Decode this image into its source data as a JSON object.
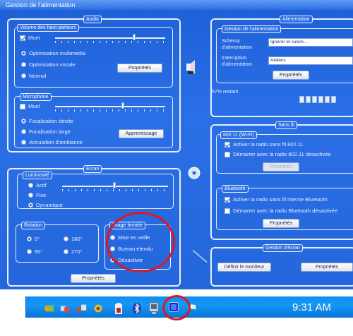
{
  "window": {
    "title": "Gestion de l'alimentation",
    "left_icons": [
      "speaker-icon",
      "microphone-icon"
    ],
    "center_icon": "cd-icon"
  },
  "audio": {
    "title": "Audio",
    "volume": {
      "legend": "Volume des haut-parleurs",
      "mute_label": "Muet",
      "mute_checked": true,
      "level_fraction": 0.72,
      "modes": [
        {
          "label": "Optimisation multimédia",
          "selected": true
        },
        {
          "label": "Optimisation vocale",
          "selected": false
        },
        {
          "label": "Normal",
          "selected": false
        }
      ],
      "properties_label": "Propriétés"
    },
    "micro": {
      "legend": "Microphone",
      "mute_label": "Muet",
      "mute_checked": false,
      "level_fraction": 0.62,
      "modes": [
        {
          "label": "Focalisation étroite",
          "selected": true
        },
        {
          "label": "Focalisation large",
          "selected": false
        },
        {
          "label": "Annulation d'ambiance",
          "selected": false
        }
      ],
      "learn_label": "Apprentissage"
    }
  },
  "screen": {
    "title": "Écran",
    "brightness": {
      "legend": "Luminosité",
      "modes": [
        {
          "label": "Actif",
          "selected": false
        },
        {
          "label": "Fixe",
          "selected": false
        },
        {
          "label": "Dynamique",
          "selected": true
        }
      ],
      "level_fraction": 0.5
    },
    "rotation": {
      "legend": "Rotation",
      "options": [
        {
          "label": "0°",
          "selected": true
        },
        {
          "label": "90°",
          "selected": false
        },
        {
          "label": "180°",
          "selected": false
        },
        {
          "label": "270°",
          "selected": false
        }
      ]
    },
    "image_closed": {
      "legend": "Image fermée",
      "options": [
        {
          "label": "Mise en veille",
          "selected": false
        },
        {
          "label": "Bureau étendu",
          "selected": false
        },
        {
          "label": "Désactiver",
          "selected": true
        }
      ]
    },
    "properties_label": "Propriétés"
  },
  "power": {
    "title": "Alimentation",
    "legend": "Gestion de l'alimentation",
    "scheme_label": "Schéma d'alimentation",
    "scheme_value": "Ignorer et suivre...",
    "source_label": "Interruption d'alimentation",
    "source_value": "Ateliers",
    "properties_label": "Propriétés",
    "battery_text": "57% restant",
    "battery_segments": 6
  },
  "wireless": {
    "title": "Sans fil",
    "wifi": {
      "legend": "802.11 (Wi-Fi)",
      "items": [
        {
          "label": "Activer la radio sans fil 802.11",
          "checked": true
        },
        {
          "label": "Démarrer avec la radio 802.11 désactivée",
          "checked": false
        }
      ],
      "button_label": "Propriétés"
    },
    "bluetooth": {
      "legend": "Bluetooth",
      "items": [
        {
          "label": "Activer la radio sans fil interne Bluetooth",
          "checked": true
        },
        {
          "label": "Démarrer avec la radio Bluetooth désactivée",
          "checked": false
        }
      ],
      "button_label": "Propriétés"
    }
  },
  "display_mgmt": {
    "legend": "Gestion d'écran",
    "primary_label": "Définir le moniteur",
    "properties_label": "Propriétés"
  },
  "taskbar": {
    "clock": "9:31 AM",
    "icons": [
      "network-icon",
      "users-icon",
      "connection-icon",
      "volume-icon",
      "battery-icon",
      "bluetooth-icon",
      "monitor-icon",
      "mobility-center-icon",
      "flag-icon"
    ],
    "highlight_color": "#e0161a"
  }
}
